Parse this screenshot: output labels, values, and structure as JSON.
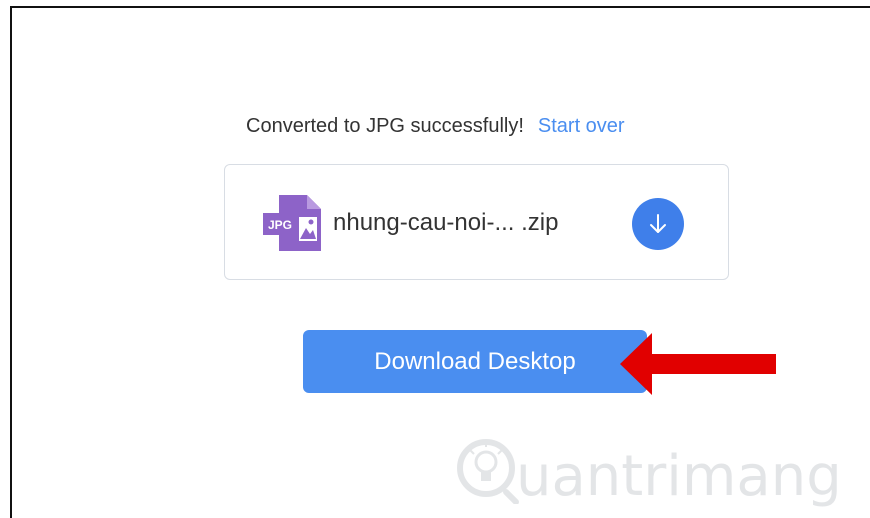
{
  "status": {
    "message": "Converted to JPG successfully!",
    "start_over": "Start over"
  },
  "file": {
    "icon_label": "JPG",
    "name": "nhung-cau-noi-... .zip",
    "icon": "download-arrow-icon"
  },
  "desktop_button": {
    "label": "Download Desktop"
  },
  "watermark": {
    "text": "uantrimang"
  },
  "colors": {
    "accent": "#4a8ef0",
    "jpg_icon": "#8d63c8",
    "arrow": "#e10000"
  }
}
